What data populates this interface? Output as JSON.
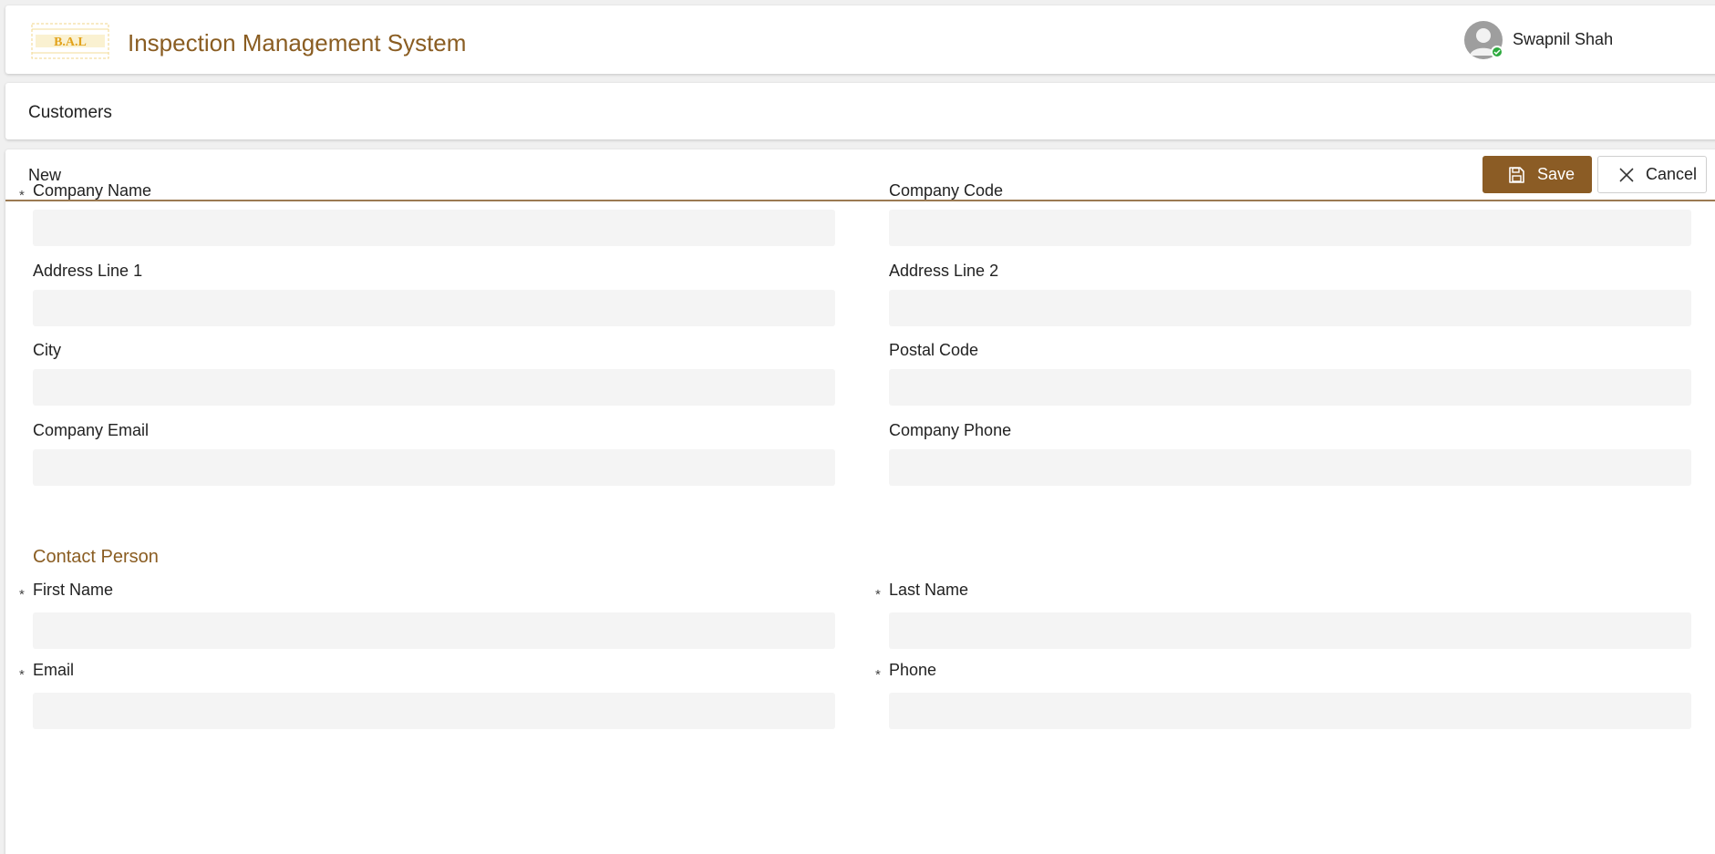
{
  "app": {
    "title": "Inspection Management System",
    "logo_text": "B.A.L",
    "user_name": "Swapnil Shah",
    "accent_color": "#8b5c25",
    "status_color": "#2eaa3f"
  },
  "breadcrumb": {
    "current": "Customers"
  },
  "form": {
    "mode": "New",
    "save_label": "Save",
    "cancel_label": "Cancel",
    "required_marker": "*",
    "fields": {
      "company_name": {
        "label": "Company Name",
        "value": ""
      },
      "company_code": {
        "label": "Company Code",
        "value": ""
      },
      "address_line_1": {
        "label": "Address Line 1",
        "value": ""
      },
      "address_line_2": {
        "label": "Address Line 2",
        "value": ""
      },
      "city": {
        "label": "City",
        "value": ""
      },
      "postal_code": {
        "label": "Postal Code",
        "value": ""
      },
      "company_email": {
        "label": "Company Email",
        "value": ""
      },
      "company_phone": {
        "label": "Company Phone",
        "value": ""
      }
    },
    "contact_section": {
      "title": "Contact Person",
      "fields": {
        "first_name": {
          "label": "First Name",
          "value": ""
        },
        "last_name": {
          "label": "Last Name",
          "value": ""
        },
        "email": {
          "label": "Email",
          "value": ""
        },
        "phone": {
          "label": "Phone",
          "value": ""
        }
      }
    }
  },
  "icons": {
    "save": "floppy-disk-icon",
    "cancel": "close-icon",
    "avatar": "user-avatar-icon"
  }
}
